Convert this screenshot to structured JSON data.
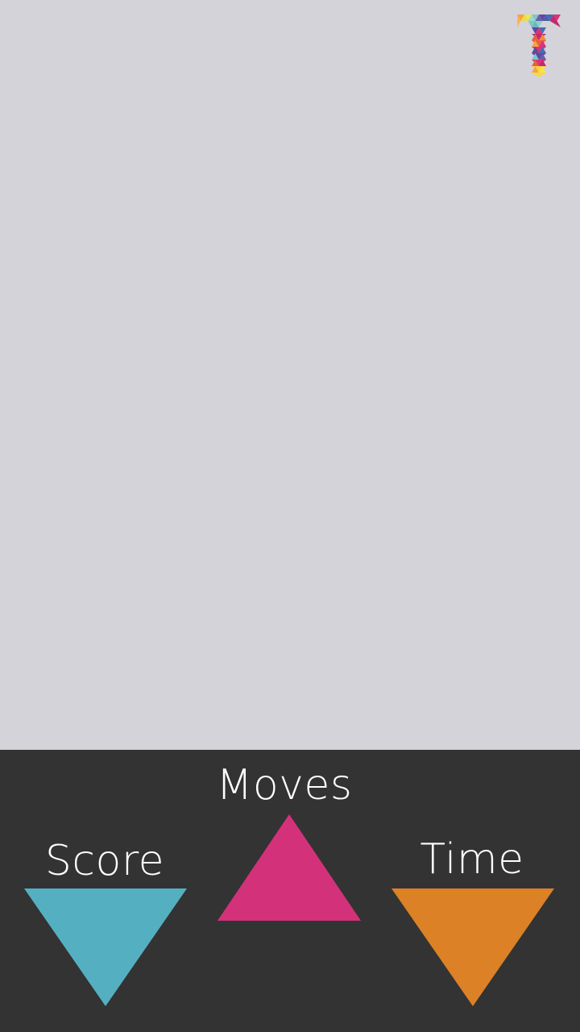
{
  "logo": {
    "icon": "tris-logo-icon",
    "colors": [
      "#f4a53c",
      "#ede84b",
      "#7fc6c4",
      "#5b4aa0",
      "#d9337a",
      "#e8613f",
      "#3f6fb5",
      "#f7d84a"
    ]
  },
  "hud": {
    "moves_label": "Moves",
    "score_label": "Score",
    "time_label": "Time"
  },
  "colors": {
    "board_background": "#d4d3d9",
    "panel_background": "#333333",
    "moves": "#d3327a",
    "score": "#54b0c1",
    "time": "#dc8126"
  }
}
